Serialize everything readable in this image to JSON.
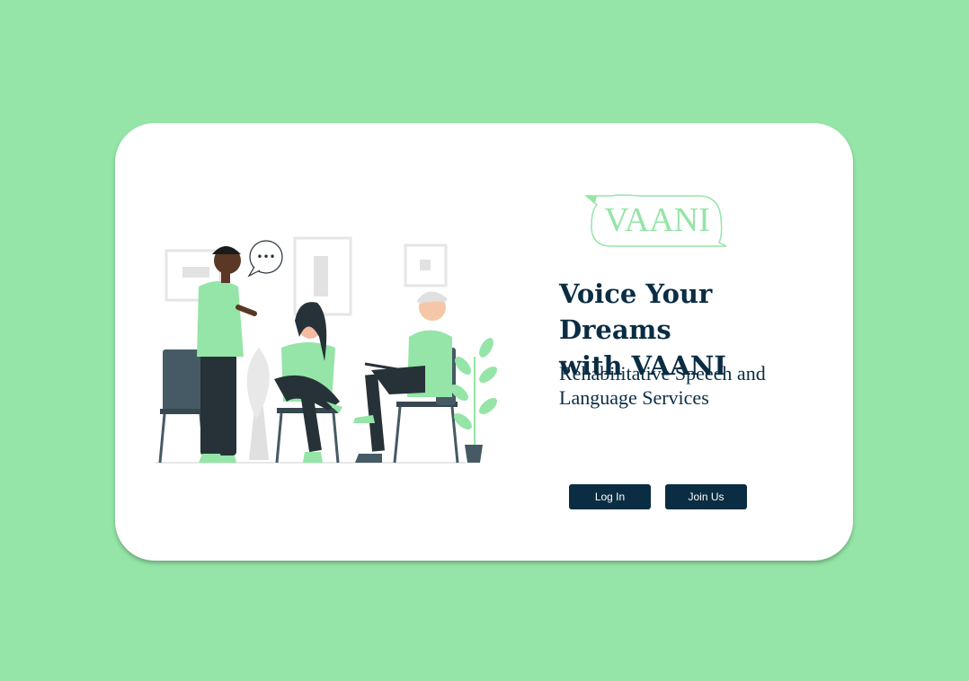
{
  "brand": {
    "name": "VAANI",
    "color": "#94e5a7",
    "dark": "#0a2d43"
  },
  "hero": {
    "headline_line1": "Voice Your Dreams",
    "headline_line2": "with VAANI",
    "subtitle_line1": "Rehabilitative Speech and",
    "subtitle_line2": "Language Services"
  },
  "actions": {
    "login_label": "Log In",
    "join_label": "Join Us"
  },
  "illustration": {
    "speech_bubble_text": "•••"
  },
  "colors": {
    "background": "#94e5a7",
    "card": "#ffffff",
    "button": "#0a2d43"
  }
}
